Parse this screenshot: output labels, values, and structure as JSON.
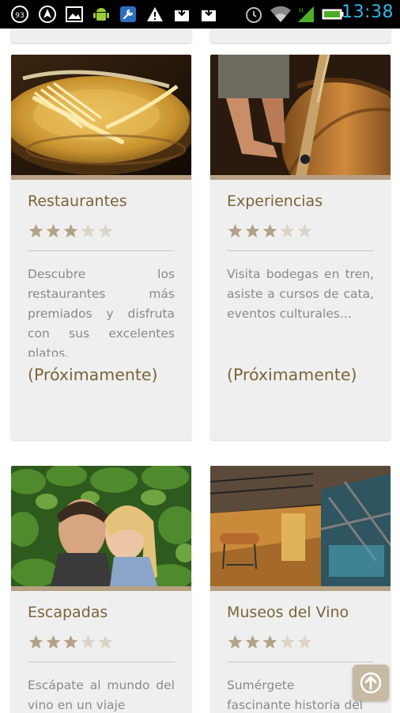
{
  "status_bar": {
    "time": "13:38",
    "icons": [
      "notification-93-icon",
      "navigation-icon",
      "gallery-icon",
      "android-icon",
      "wrench-icon",
      "warning-icon",
      "download-icon",
      "download2-icon",
      "alarm-icon",
      "wifi-icon",
      "signal-icon",
      "battery-icon"
    ],
    "accent_color": "#33b5e5"
  },
  "colors": {
    "title": "#7a6539",
    "text": "#8a8a8a",
    "card_bg": "#efefef",
    "bar": "#b7a184",
    "star_on": "#b3a287",
    "star_off": "#dcd4c6"
  },
  "cards": [
    {
      "title": "Restaurantes",
      "rating": 3,
      "max_rating": 5,
      "description": "Descubre los restaurantes más premiados y disfruta con sus excelentes platos.",
      "soon": "(Próximamente)",
      "image_icon": "golden-fork-plate-image"
    },
    {
      "title": "Experiencias",
      "rating": 3,
      "max_rating": 5,
      "description": "Visita bodegas en tren, asiste a cursos de cata, eventos culturales...",
      "soon": "(Próximamente)",
      "image_icon": "wine-barrel-feet-image"
    },
    {
      "title": "Escapadas",
      "rating": 3,
      "max_rating": 5,
      "description": "Escápate al mundo del vino en un viaje",
      "image_icon": "couple-vineyard-image"
    },
    {
      "title": "Museos del Vino",
      "rating": 3,
      "max_rating": 5,
      "description": "Sumérgete en fascinante historia del",
      "image_icon": "wine-museum-image"
    }
  ],
  "scroll_top_button": {
    "icon": "arrow-up-icon"
  }
}
